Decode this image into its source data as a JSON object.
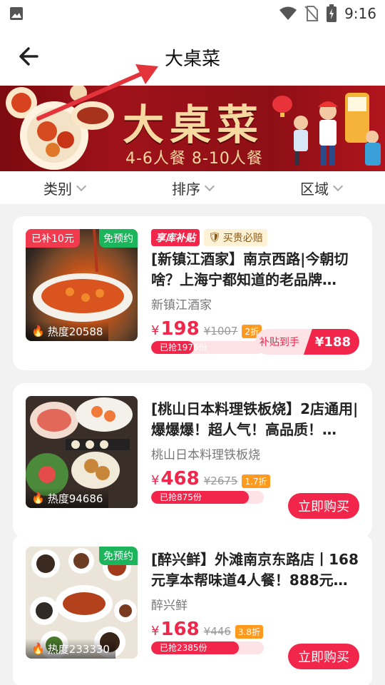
{
  "statusbar": {
    "time": "9:16"
  },
  "navbar": {
    "title": "大桌菜"
  },
  "banner": {
    "title": "大桌菜",
    "subtitle": "4-6人餐  8-10人餐"
  },
  "filters": [
    {
      "label": "类别"
    },
    {
      "label": "排序"
    },
    {
      "label": "区域"
    }
  ],
  "cards": [
    {
      "tag_left": "已补10元",
      "tag_right": "免预约",
      "heat": "热度20588",
      "badge1": "享库补贴",
      "badge2": "买贵必赔",
      "title": "[新镇江酒家】南京西路|今朝切啥？上海宁都知道的老品牌…",
      "shop": "新镇江酒家",
      "yen": "¥",
      "price": "198",
      "oprice": "¥1007",
      "discount": "2折",
      "sold": "已抢1976份",
      "progress": 0.38,
      "subsidy_label": "补贴到手",
      "subsidy_price": "¥188"
    },
    {
      "heat": "热度94686",
      "title": "[桃山日本料理铁板烧】2店通用|爆爆爆！超人气！高品质！…",
      "shop": "桃山日本料理铁板烧",
      "yen": "¥",
      "price": "468",
      "oprice": "¥2675",
      "discount": "1.7折",
      "sold": "已抢875份",
      "progress": 0.87,
      "buy": "立即购买"
    },
    {
      "tag_right": "免预约",
      "heat": "热度233330",
      "title": "[醉兴鲜】外滩南京东路店丨168元享本帮味道4人餐！888元…",
      "shop": "醉兴鲜",
      "yen": "¥",
      "price": "168",
      "oprice": "¥446",
      "discount": "3.8折",
      "sold": "已抢2385份",
      "progress": 0.78,
      "buy": "立即购买"
    }
  ],
  "colors": {
    "accent": "#f2264a",
    "banner": "#8d0f15",
    "green": "#1cb55c"
  }
}
